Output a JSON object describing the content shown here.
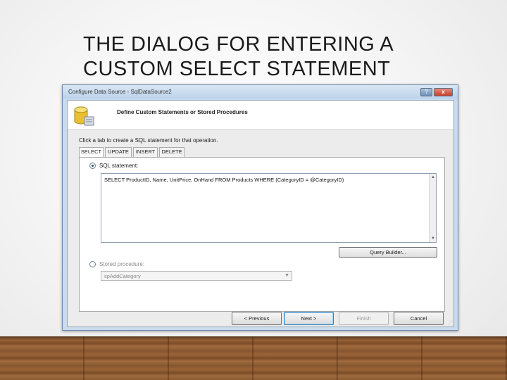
{
  "slide": {
    "title_line1": "THE DIALOG FOR ENTERING A",
    "title_line2": "CUSTOM SELECT STATEMENT"
  },
  "dialog": {
    "window_title": "Configure Data Source - SqlDataSource2",
    "help_glyph": "?",
    "close_glyph": "x",
    "header_title": "Define Custom Statements or Stored Procedures",
    "header_icon": "database-icon",
    "instruction": "Click a tab to create a SQL statement for that operation.",
    "tabs": [
      {
        "label": "SELECT",
        "active": true
      },
      {
        "label": "UPDATE",
        "active": false
      },
      {
        "label": "INSERT",
        "active": false
      },
      {
        "label": "DELETE",
        "active": false
      }
    ],
    "sql_statement_label": "SQL statement:",
    "sql_statement_value": "SELECT ProductID, Name, UnitPrice, OnHand FROM Products WHERE (CategoryID = @CategoryID)",
    "query_builder_label": "Query Builder...",
    "stored_procedure_label": "Stored procedure:",
    "stored_procedure_value": "spAddCategory",
    "buttons": {
      "previous": "< Previous",
      "next": "Next >",
      "finish": "Finish",
      "cancel": "Cancel"
    }
  },
  "colors": {
    "window_frame": "#c9dcef",
    "client_bg": "#ececec",
    "floor_wood": "#8a5a32"
  }
}
